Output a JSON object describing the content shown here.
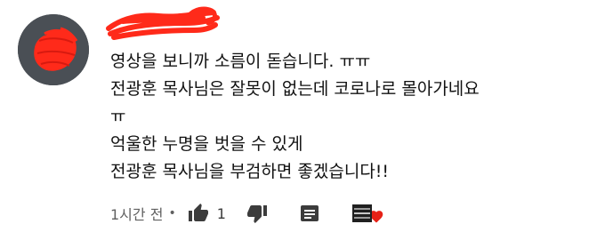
{
  "comment": {
    "lines": [
      "영상을 보니까 소름이 돋습니다. ㅠㅠ",
      "전광훈 목사님은 잘못이 없는데 코로나로 몰아가네요",
      "ㅠ",
      "억울한 누명을 벗을 수 있게",
      "전광훈 목사님을 부검하면 좋겠습니다!!"
    ]
  },
  "actions": {
    "timestamp": "1시간 전",
    "separator": "•",
    "like_count": "1"
  },
  "icons": {
    "avatar": "user-avatar-scribbled",
    "author_name": "redacted-name-scribble",
    "like": "thumb-up-icon",
    "dislike": "thumb-down-icon",
    "reply": "reply-icon",
    "creator_heart": "creator-heart-icon"
  },
  "colors": {
    "avatar_bg": "#4a4f55",
    "scribble_red": "#ff2a1a",
    "heart": "#e62117",
    "meta_text": "#606060",
    "icon_dark": "#3c3c3c"
  }
}
